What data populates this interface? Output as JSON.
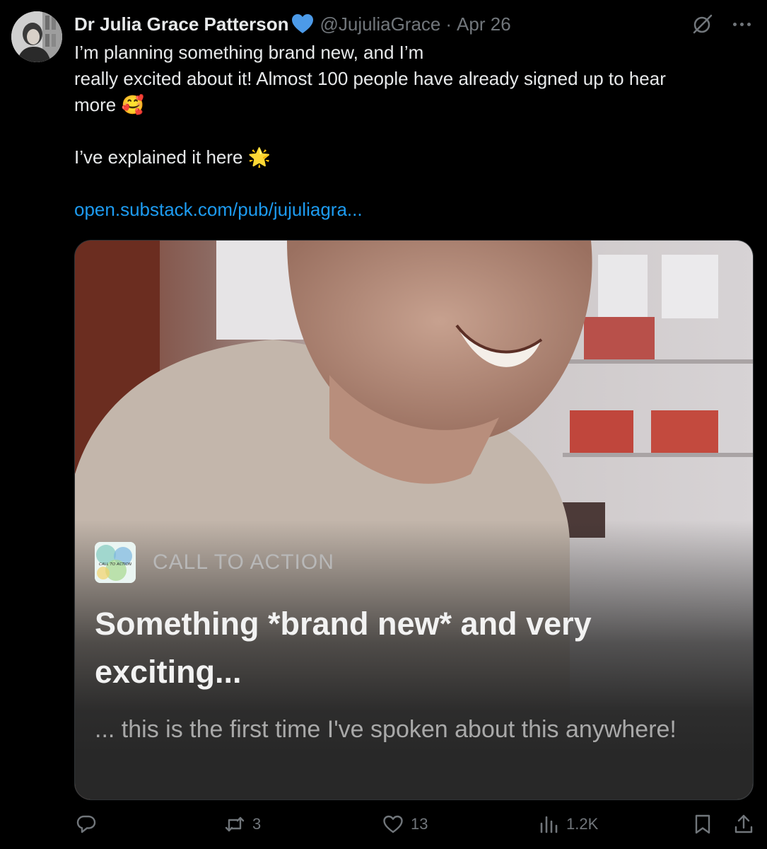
{
  "author": {
    "display_name": "Dr Julia Grace Patterson",
    "verified_badge": "blue-heart-icon",
    "handle": "@JujuliaGrace",
    "separator": "·",
    "date": "Apr 26"
  },
  "tweet": {
    "line1": "I’m planning something brand new, and I’m",
    "line2": "really excited about it! Almost 100 people have already signed up to hear",
    "line3_text": "more ",
    "line3_emoji": "🥰",
    "line4_text": "I’ve explained it here ",
    "line4_emoji": "🌟",
    "link": "open.substack.com/pub/jujuliagra..."
  },
  "card": {
    "publication": "CALL TO ACTION",
    "logo_text": "CALL TO ACTION",
    "title": "Something *brand new* and very exciting...",
    "subtitle": "... this is the first time I've spoken about this anywhere!"
  },
  "actions": {
    "replies": "",
    "retweets": "3",
    "likes": "13",
    "views": "1.2K"
  },
  "colors": {
    "background": "#000000",
    "text": "#e7e9ea",
    "muted": "#71767b",
    "link": "#1d9bf0",
    "verified": "#4c9ae8"
  }
}
